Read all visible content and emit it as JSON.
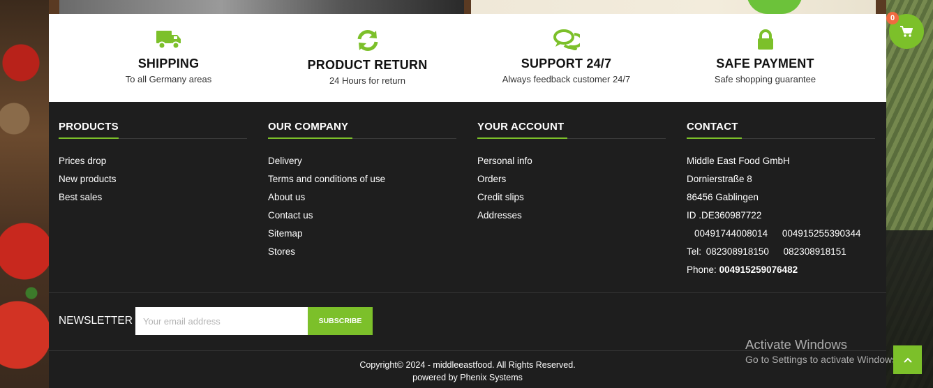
{
  "features": [
    {
      "icon": "truck-icon",
      "title": "SHIPPING",
      "subtitle": "To all Germany areas"
    },
    {
      "icon": "refresh-icon",
      "title": "PRODUCT RETURN",
      "subtitle": "24 Hours for return"
    },
    {
      "icon": "chat-icon",
      "title": "SUPPORT 24/7",
      "subtitle": "Always feedback customer 24/7"
    },
    {
      "icon": "lock-icon",
      "title": "SAFE PAYMENT",
      "subtitle": "Safe shopping guarantee"
    }
  ],
  "footer": {
    "products": {
      "title": "PRODUCTS",
      "links": [
        "Prices drop",
        "New products",
        "Best sales"
      ]
    },
    "company": {
      "title": "OUR COMPANY",
      "links": [
        "Delivery",
        "Terms and conditions of use",
        "About us",
        "Contact us",
        "Sitemap",
        "Stores"
      ]
    },
    "account": {
      "title": "YOUR ACCOUNT",
      "links": [
        "Personal info",
        "Orders",
        "Credit slips",
        "Addresses"
      ]
    },
    "contact": {
      "title": "CONTACT",
      "company_name": "Middle East Food GmbH",
      "street": "Dornierstraße 8",
      "city": "86456 Gablingen",
      "id": "ID .DE360987722",
      "mobile1": "00491744008014",
      "mobile2": "004915255390344",
      "tel_label": "Tel:",
      "tel1": "082308918150",
      "tel2": "082308918151",
      "phone_label": "Phone:",
      "phone": "004915259076482"
    }
  },
  "newsletter": {
    "label": "NEWSLETTER",
    "placeholder": "Your email address",
    "button": "SUBSCRIBE"
  },
  "copyright": {
    "line1": "Copyright© 2024 - middleeastfood. All Rights Reserved.",
    "line2": "powered by Phenix Systems"
  },
  "cart": {
    "count": "0",
    "icon": "cart-icon"
  },
  "watermark": {
    "title": "Activate Windows",
    "subtitle": "Go to Settings to activate Windows."
  },
  "colors": {
    "accent": "#7cc02a",
    "footer_bg": "#1e1e1e",
    "badge": "#f06a40"
  }
}
